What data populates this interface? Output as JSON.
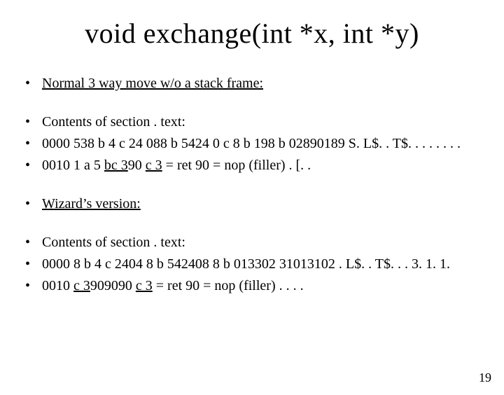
{
  "title": "void exchange(int *x, int *y)",
  "groups": [
    {
      "lines": [
        {
          "mode": "underline",
          "text": "Normal 3 way move w/o a stack frame:"
        }
      ]
    },
    {
      "lines": [
        {
          "mode": "plain",
          "text": "Contents of section . text:"
        },
        {
          "mode": "plain",
          "text": "0000 538 b 4 c 24 088 b 5424 0 c 8 b 198 b 02890189  S. L$. . T$. . . . . . . ."
        },
        {
          "mode": "mixed",
          "runs": [
            {
              "u": false,
              "t": "0010 1 a 5 "
            },
            {
              "u": true,
              "t": "bc 3"
            },
            {
              "u": false,
              "t": "90     "
            },
            {
              "u": true,
              "t": "c 3"
            },
            {
              "u": false,
              "t": " = ret   90 = nop (filler)            . [. ."
            }
          ]
        }
      ]
    },
    {
      "lines": [
        {
          "mode": "underline",
          "text": "Wizard’s version:"
        }
      ]
    },
    {
      "lines": [
        {
          "mode": "plain",
          "text": "Contents of section . text:"
        },
        {
          "mode": "plain",
          "text": "0000 8 b 4 c 2404 8 b 542408 8 b 013302 31013102  . L$. . T$. . . 3. 1. 1."
        },
        {
          "mode": "mixed",
          "runs": [
            {
              "u": false,
              "t": "0010 "
            },
            {
              "u": true,
              "t": "c 3"
            },
            {
              "u": false,
              "t": "909090     "
            },
            {
              "u": true,
              "t": "c 3"
            },
            {
              "u": false,
              "t": " = ret   90 = nop (filler)             . . . ."
            }
          ]
        }
      ]
    }
  ],
  "page_number": "19"
}
